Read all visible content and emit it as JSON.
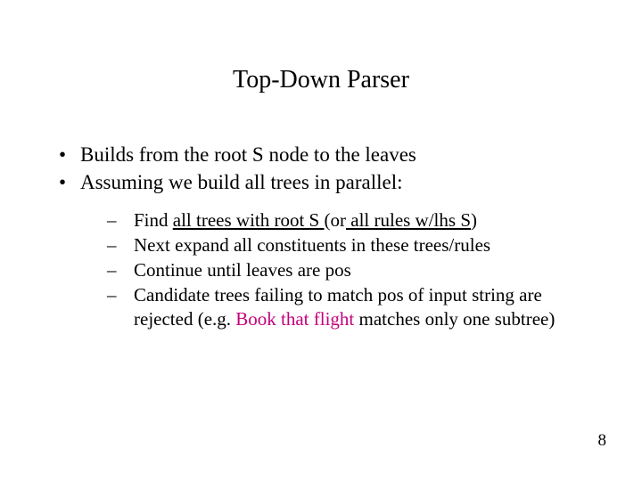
{
  "title": "Top-Down Parser",
  "bullets": {
    "b1": "Builds from the root S node to the leaves",
    "b2": "Assuming we build all trees in parallel:"
  },
  "sub": {
    "dash": "–",
    "s1": {
      "pre": "Find ",
      "u1": "all trees with root S ",
      "mid": "(or",
      "u2": " all rules w/lhs S",
      "post": ")"
    },
    "s2": "Next expand all constituents in these trees/rules",
    "s3": "Continue until leaves are pos",
    "s4": {
      "pre": "Candidate trees failing to match pos of input string are rejected (e.g. ",
      "em": "Book that flight",
      "post": " matches only one subtree)"
    }
  },
  "page_number": "8"
}
